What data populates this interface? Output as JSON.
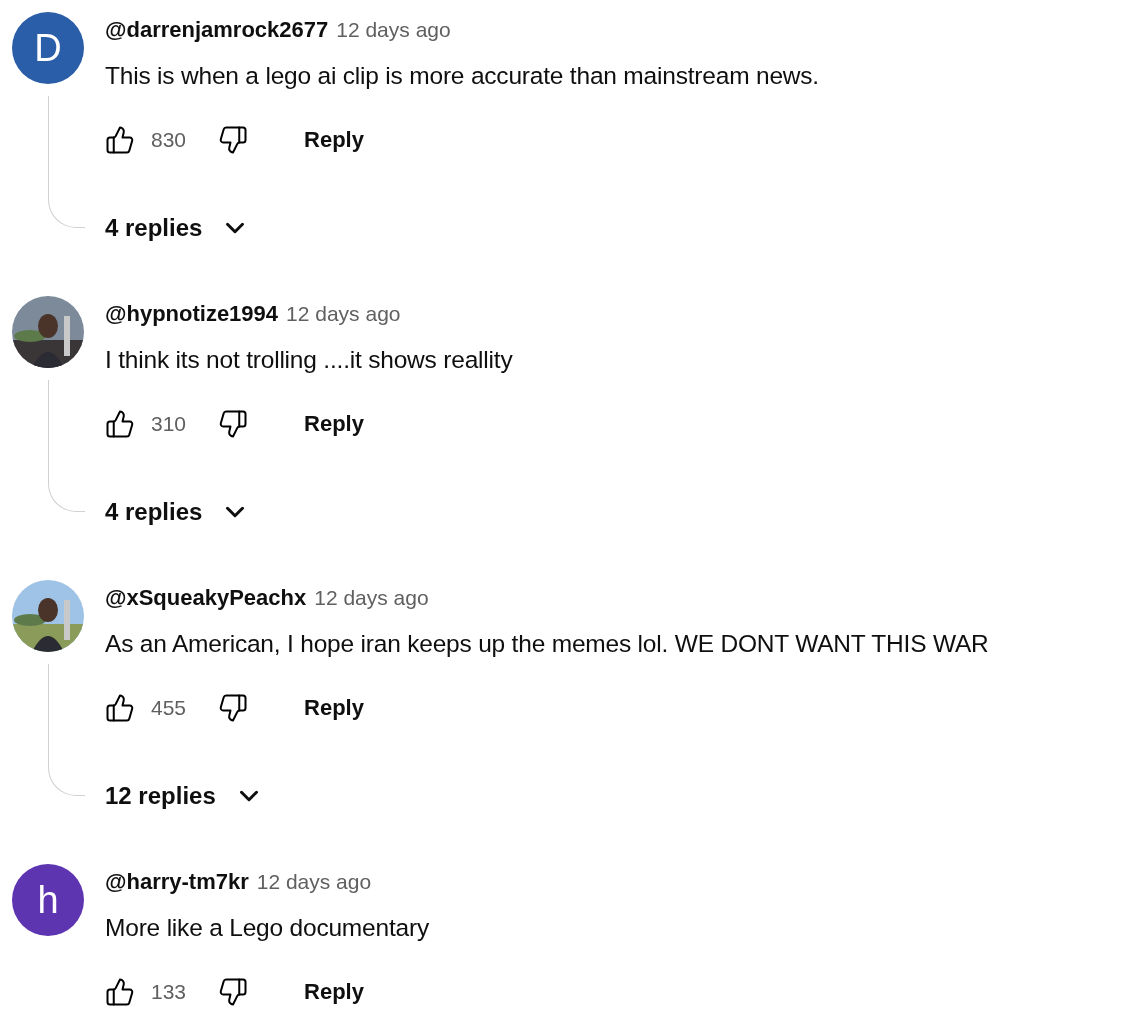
{
  "comments": [
    {
      "avatar": {
        "kind": "letter",
        "letter": "D",
        "color": "#2a5ea8"
      },
      "author": "@darrenjamrock2677",
      "time": "12 days ago",
      "text": "This is when a lego ai clip is more accurate than mainstream news.",
      "likes": "830",
      "reply": "Reply",
      "replies": "4 replies"
    },
    {
      "author": "@hypnotize1994",
      "time": "12 days ago",
      "text": "I think its not trolling ....it shows reallity",
      "likes": "310",
      "reply": "Reply",
      "replies": "4 replies"
    },
    {
      "author": "@xSqueakyPeachx",
      "time": "12 days ago",
      "text": "As an American, I hope iran keeps up the memes lol. WE DONT WANT THIS WAR",
      "likes": "455",
      "reply": "Reply",
      "replies": "12 replies"
    },
    {
      "avatar": {
        "kind": "letter",
        "letter": "h",
        "color": "#5e35b1"
      },
      "author": "@harry-tm7kr",
      "time": "12 days ago",
      "text": "More like a Lego documentary",
      "likes": "133",
      "reply": "Reply"
    }
  ]
}
